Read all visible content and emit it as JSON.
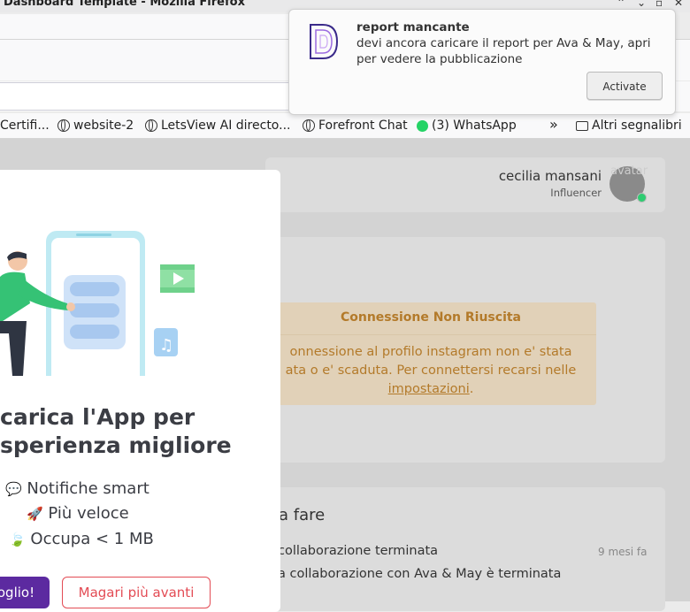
{
  "window": {
    "title": "Dashboard Template - Mozilla Firefox"
  },
  "bookmarks": {
    "items": [
      "Certifi...",
      "website-2",
      "LetsView AI directo...",
      "Forefront Chat",
      "(3) WhatsApp"
    ],
    "overflow": "»",
    "other": "Altri segnalibri"
  },
  "user": {
    "name": "cecilia mansani",
    "role": "Influencer",
    "avatar_alt": "avatar"
  },
  "alert": {
    "title": "Connessione Non Riuscita",
    "line1": "onnessione al profilo instagram non e' stata",
    "line2": "ata o e' scaduta. Per connettersi recarsi nelle",
    "link": "impostazioni",
    "after_link": "."
  },
  "todo": {
    "title": "la fare",
    "item": "collaborazione terminata",
    "time": "9 mesi fa",
    "desc": "a collaborazione con Ava & May è terminata"
  },
  "modal": {
    "title_line1": "carica l'App per",
    "title_line2": "sperienza migliore",
    "features": [
      {
        "emoji": "💬",
        "text": "Notifiche smart"
      },
      {
        "emoji": "🚀",
        "text": "Più veloce"
      },
      {
        "emoji": "🍃",
        "text": "Occupa < 1 MB"
      }
    ],
    "primary_button": "oglio!",
    "secondary_button": "Magari più avanti"
  },
  "notification": {
    "title": "report mancante",
    "body": "devi ancora caricare il report per Ava & May, apri per vedere la pubblicazione",
    "button": "Activate"
  },
  "colors": {
    "accent": "#5c2aa0",
    "danger": "#e34c55",
    "warning_text": "#b37a2a",
    "online": "#2ecc71"
  }
}
